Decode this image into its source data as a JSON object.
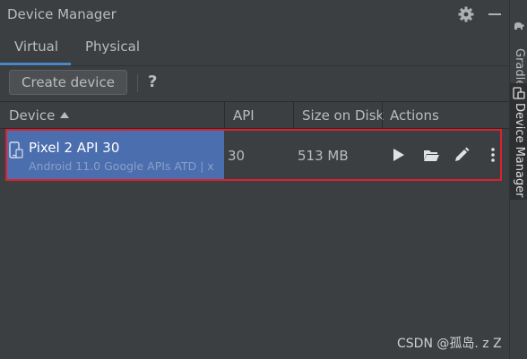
{
  "panel": {
    "title": "Device Manager"
  },
  "tabs": [
    {
      "label": "Virtual",
      "active": true
    },
    {
      "label": "Physical",
      "active": false
    }
  ],
  "toolbar": {
    "create_label": "Create device",
    "help_label": "?"
  },
  "table": {
    "columns": [
      "Device",
      "API",
      "Size on Disk",
      "Actions"
    ],
    "sort_column": "Device",
    "sort_direction": "ascending",
    "rows": [
      {
        "name": "Pixel 2 API 30",
        "subtitle": "Android 11.0 Google APIs ATD | x",
        "api": "30",
        "size": "513 MB",
        "actions": [
          "play-icon",
          "folder-icon",
          "edit-icon",
          "more-icon"
        ]
      }
    ]
  },
  "sidebar": {
    "gradle_label": "Gradle",
    "device_manager_label": "Device Manager"
  },
  "watermark": "CSDN @孤岛. z Z",
  "colors": {
    "background": "#3c3f41",
    "selection": "#4b6eaf",
    "accent": "#4a88c7",
    "highlight_border": "#e0202e"
  }
}
